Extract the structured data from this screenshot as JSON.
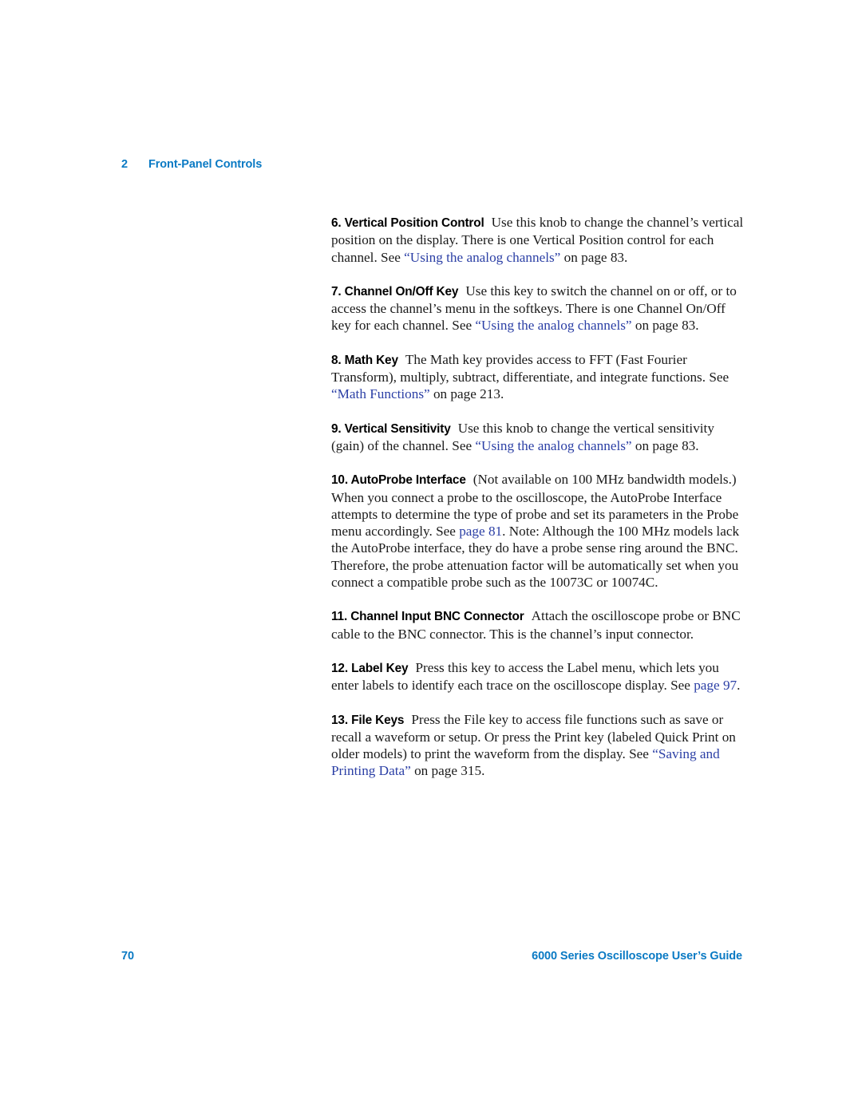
{
  "header": {
    "chapter_number": "2",
    "chapter_title": "Front-Panel Controls",
    "color": "#0a7ac4"
  },
  "colors": {
    "header_blue": "#0a7ac4",
    "link_blue": "#2b3fa5",
    "body_black": "#1a1a1a"
  },
  "body": {
    "paragraphs": [
      {
        "lead_in": "6. Vertical Position Control",
        "runs": [
          {
            "text": "Use this knob to change the channel’s vertical position on the display. There is one Vertical Position control for each channel. See ",
            "link": false
          },
          {
            "text": "“Using the analog channels”",
            "link": true
          },
          {
            "text": " on page 83.",
            "link": false
          }
        ]
      },
      {
        "lead_in": "7. Channel On/Off Key",
        "runs": [
          {
            "text": "Use this key to switch the channel on or off, or to access the channel’s menu in the softkeys. There is one Channel On/Off key for each channel. See ",
            "link": false
          },
          {
            "text": "“Using the analog channels”",
            "link": true
          },
          {
            "text": " on page 83.",
            "link": false
          }
        ]
      },
      {
        "lead_in": "8. Math Key",
        "runs": [
          {
            "text": "The Math key provides access to FFT (Fast Fourier Transform), multiply, subtract, differentiate, and integrate functions. See ",
            "link": false
          },
          {
            "text": "“Math Functions”",
            "link": true
          },
          {
            "text": " on page 213.",
            "link": false
          }
        ]
      },
      {
        "lead_in": "9. Vertical Sensitivity",
        "runs": [
          {
            "text": "Use this knob to change the vertical sensitivity (gain) of the channel. See ",
            "link": false
          },
          {
            "text": "“Using the analog channels”",
            "link": true
          },
          {
            "text": " on page 83.",
            "link": false
          }
        ]
      },
      {
        "lead_in": "10. AutoProbe Interface",
        "runs": [
          {
            "text": "(Not available on 100 MHz bandwidth models.) When you connect a probe to the oscilloscope, the AutoProbe Interface attempts to determine the type of probe and set its parameters in the Probe menu accordingly. See ",
            "link": false
          },
          {
            "text": "page 81",
            "link": true
          },
          {
            "text": ". Note: Although the 100 MHz models lack the AutoProbe interface, they do have a probe sense ring around the BNC. Therefore, the probe attenuation factor will be automatically set when you connect a compatible probe such as the 10073C or 10074C.",
            "link": false
          }
        ]
      },
      {
        "lead_in": "11. Channel Input BNC Connector",
        "runs": [
          {
            "text": "Attach the oscilloscope probe or BNC cable to the BNC connector. This is the channel’s input connector.",
            "link": false
          }
        ]
      },
      {
        "lead_in": "12. Label Key",
        "runs": [
          {
            "text": "Press this key to access the Label menu, which lets you enter labels to identify each trace on the oscilloscope display. See ",
            "link": false
          },
          {
            "text": "page 97",
            "link": true
          },
          {
            "text": ".",
            "link": false
          }
        ]
      },
      {
        "lead_in": "13. File Keys",
        "runs": [
          {
            "text": "Press the File key to access file functions such as save or recall a waveform or setup. Or press the Print key (labeled Quick Print on older models) to print the waveform from the display. See ",
            "link": false
          },
          {
            "text": "“Saving and Printing Data”",
            "link": true
          },
          {
            "text": " on page 315.",
            "link": false
          }
        ]
      }
    ]
  },
  "footer": {
    "page_number": "70",
    "document_title": "6000 Series Oscilloscope User’s Guide",
    "color": "#0a7ac4"
  }
}
